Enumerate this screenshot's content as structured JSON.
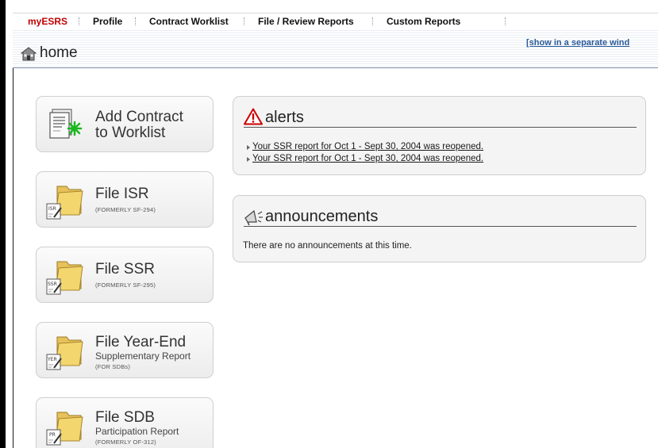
{
  "nav": {
    "items": [
      {
        "label": "myESRS",
        "active": true
      },
      {
        "label": "Profile",
        "active": false
      },
      {
        "label": "Contract Worklist",
        "active": false
      },
      {
        "label": "File / Review Reports",
        "active": false
      },
      {
        "label": "Custom Reports",
        "active": false
      }
    ]
  },
  "header": {
    "title": "home",
    "separate_window_link": "[show in a separate wind",
    "icon": "home-icon"
  },
  "tiles": [
    {
      "title": "Add Contract",
      "title2": "to Worklist",
      "icon": "add-contract-icon"
    },
    {
      "title": "File ISR",
      "small": "(FORMERLY SF-294)",
      "badge": "ISR",
      "icon": "folder-isr-icon"
    },
    {
      "title": "File SSR",
      "small": "(FORMERLY SF-295)",
      "badge": "SSR",
      "icon": "folder-ssr-icon"
    },
    {
      "title": "File Year-End",
      "sub": "Supplementary Report",
      "small": "(FOR SDBs)",
      "badge": "YER",
      "icon": "folder-yer-icon"
    },
    {
      "title": "File SDB",
      "sub": "Participation Report",
      "small": "(FORMERLY OF-312)",
      "badge": "PR",
      "icon": "folder-pr-icon"
    }
  ],
  "alerts": {
    "title": "alerts",
    "icon": "warning-icon",
    "items": [
      "Your SSR report for Oct 1 - Sept 30, 2004 was reopened.",
      "Your SSR report for Oct 1 - Sept 30, 2004 was reopened."
    ]
  },
  "announcements": {
    "title": "announcements",
    "icon": "megaphone-icon",
    "text": "There are no announcements at this time."
  },
  "colors": {
    "active_nav": "#c00000",
    "link_blue": "#2a5b9b",
    "alert_red": "#cc0000"
  }
}
